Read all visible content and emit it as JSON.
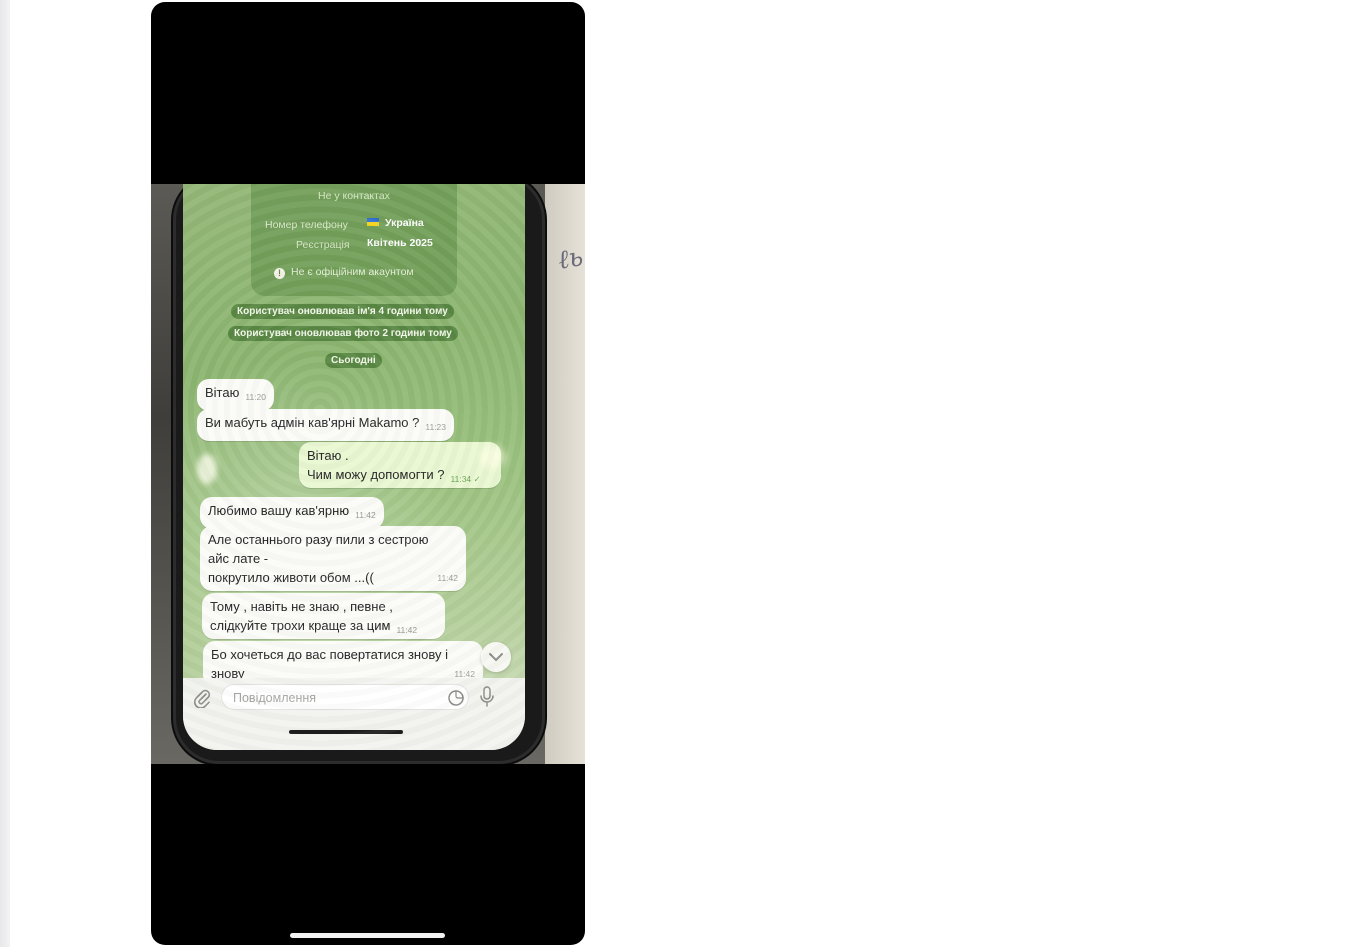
{
  "profile_card": {
    "not_in_contacts": "Не у контактах",
    "phone_label": "Номер телефону",
    "phone_value": "Україна",
    "registration_label": "Реєстрація",
    "registration_value": "Квітень 2025",
    "notice": "Не є офіційним акаунтом"
  },
  "service_messages": {
    "name_update": "Користувач оновлював ім'я 4 години тому",
    "photo_update": "Користувач оновлював фото 2 години тому",
    "date_divider": "Сьогодні"
  },
  "messages": [
    {
      "direction": "in",
      "lines": [
        "Вітаю"
      ],
      "time": "11:20"
    },
    {
      "direction": "in",
      "lines": [
        "Ви мабуть адмін кав'ярні Makamo ?"
      ],
      "time": "11:23"
    },
    {
      "direction": "out",
      "lines": [
        "Вітаю .",
        "Чим можу допомогти ?"
      ],
      "time": "11:34"
    },
    {
      "direction": "in",
      "lines": [
        "Любимо вашу кав'ярню"
      ],
      "time": "11:42"
    },
    {
      "direction": "in",
      "lines": [
        "Але останнього разу пили з сестрою",
        "айс лате -",
        "покрутило животи обом ...(("
      ],
      "time": "11:42"
    },
    {
      "direction": "in",
      "lines": [
        "Тому , навіть не знаю , певне ,",
        "слідкуйте трохи краще за цим"
      ],
      "time": "11:42"
    },
    {
      "direction": "in",
      "lines": [
        "Бо хочеться до вас повертатися знову і",
        "знову"
      ],
      "time": "11:42"
    }
  ],
  "composer": {
    "placeholder": "Повідомлення"
  },
  "icons": {
    "attach": "paperclip-icon",
    "sticker": "sticker-icon",
    "mic": "microphone-icon",
    "scroll": "chevron-down-icon",
    "warning": "exclamation-icon",
    "flag": "ukraine-flag-icon"
  },
  "colors": {
    "wallpaper": "#8cb570",
    "incoming_bubble": "#fbfbf8",
    "outgoing_bubble": "#e9f8d2",
    "service_pill": "#487834"
  }
}
